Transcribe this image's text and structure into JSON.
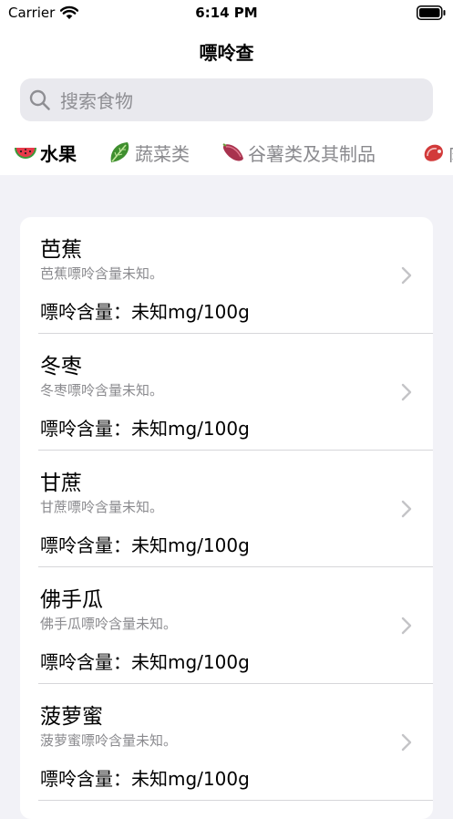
{
  "status_bar": {
    "carrier": "Carrier",
    "time": "6:14 PM"
  },
  "nav": {
    "title": "嘌呤查"
  },
  "search": {
    "placeholder": "搜索食物"
  },
  "categories": [
    {
      "label": "水果",
      "active": true,
      "icon": "watermelon-icon"
    },
    {
      "label": "蔬菜类",
      "active": false,
      "icon": "leafy-greens-icon"
    },
    {
      "label": "谷薯类及其制品",
      "active": false,
      "icon": "sweet-potato-icon"
    },
    {
      "label": "肉",
      "active": false,
      "icon": "meat-icon"
    }
  ],
  "foods": [
    {
      "name": "芭蕉",
      "desc": "芭蕉嘌呤含量未知。",
      "purine": "嘌呤含量：未知mg/100g"
    },
    {
      "name": "冬枣",
      "desc": "冬枣嘌呤含量未知。",
      "purine": "嘌呤含量：未知mg/100g"
    },
    {
      "name": "甘蔗",
      "desc": "甘蔗嘌呤含量未知。",
      "purine": "嘌呤含量：未知mg/100g"
    },
    {
      "name": "佛手瓜",
      "desc": "佛手瓜嘌呤含量未知。",
      "purine": "嘌呤含量：未知mg/100g"
    },
    {
      "name": "菠萝蜜",
      "desc": "菠萝蜜嘌呤含量未知。",
      "purine": "嘌呤含量：未知mg/100g"
    }
  ],
  "colors": {
    "background": "#f2f2f7",
    "secondary_text": "#8a8a8e",
    "search_bg": "#e9e9ee"
  }
}
